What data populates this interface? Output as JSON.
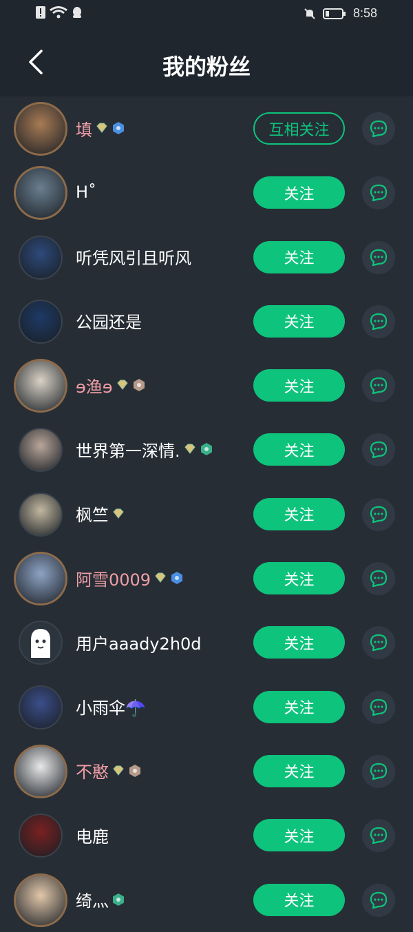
{
  "status_bar": {
    "time": "8:58"
  },
  "header": {
    "title": "我的粉丝"
  },
  "colors": {
    "accent": "#0ec37c",
    "background": "#262d35",
    "header_bg": "#1f262d",
    "vip_name": "#f29ea6"
  },
  "fans": [
    {
      "name": "填",
      "button": "互相关注",
      "mutual": true,
      "vip": true,
      "avatar_color": "#a87b54"
    },
    {
      "name": "H˚",
      "button": "关注",
      "mutual": false,
      "vip": false,
      "avatar_color": "#6a7f8f"
    },
    {
      "name": "听凭风引且听风",
      "button": "关注",
      "mutual": false,
      "vip": false,
      "avatar_color": "#2d4a7a"
    },
    {
      "name": "公园还是",
      "button": "关注",
      "mutual": false,
      "vip": false,
      "avatar_color": "#1d3a66"
    },
    {
      "name": "ɘ渔ɘ",
      "button": "关注",
      "mutual": false,
      "vip": true,
      "avatar_color": "#d8d2c6"
    },
    {
      "name": "世界第一深情.",
      "button": "关注",
      "mutual": false,
      "vip": false,
      "avatar_color": "#b9a69a"
    },
    {
      "name": "枫竺",
      "button": "关注",
      "mutual": false,
      "vip": false,
      "avatar_color": "#c2b7a0"
    },
    {
      "name": "阿雪0009",
      "button": "关注",
      "mutual": false,
      "vip": true,
      "avatar_color": "#8ea3c4"
    },
    {
      "name": "用户aaady2h0d",
      "button": "关注",
      "mutual": false,
      "vip": false,
      "avatar_color": "#2c343d"
    },
    {
      "name": "小雨伞☂️",
      "button": "关注",
      "mutual": false,
      "vip": false,
      "avatar_color": "#3b4e8a"
    },
    {
      "name": "不憨",
      "button": "关注",
      "mutual": false,
      "vip": true,
      "avatar_color": "#e8e8e8"
    },
    {
      "name": "电鹿",
      "button": "关注",
      "mutual": false,
      "vip": false,
      "avatar_color": "#7a2020"
    },
    {
      "name": "绮灬",
      "button": "关注",
      "mutual": false,
      "vip": false,
      "avatar_color": "#e2c7a9"
    }
  ]
}
